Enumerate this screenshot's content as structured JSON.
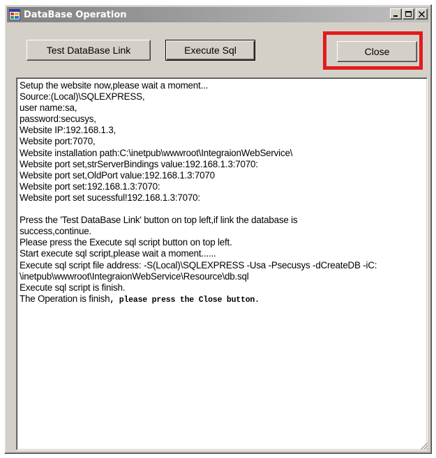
{
  "window": {
    "title": "DataBase Operation",
    "icon": "app-window-icon",
    "controls": {
      "minimize_icon": "minimize-icon",
      "maximize_icon": "maximize-icon",
      "close_icon": "close-icon"
    }
  },
  "toolbar": {
    "test_label": "Test DataBase Link",
    "execute_label": "Execute Sql",
    "close_label": "Close"
  },
  "annotation": {
    "highlight_color": "#e31b1b"
  },
  "log": {
    "lines": [
      "Setup the website now,please wait a moment...",
      "Source:(Local)\\SQLEXPRESS,",
      "user name:sa,",
      "password:secusys,",
      "Website IP:192.168.1.3,",
      "Website port:7070,",
      "Website installation path:C:\\inetpub\\wwwroot\\IntegraionWebService\\",
      "Website port set,strServerBindings value:192.168.1.3:7070:",
      "Website port set,OldPort value:192.168.1.3:7070",
      "Website port set:192.168.1.3:7070:",
      "Website port set sucessful!192.168.1.3:7070:",
      "",
      "Press the 'Test DataBase Link' button on top left,if link the database is",
      "success,continue.",
      "Please press the Execute sql script button on top left.",
      "Start execute sql script,please wait a moment......",
      "Execute sql script file address: -S(Local)\\SQLEXPRESS -Usa -Psecusys -dCreateDB -iC:",
      "\\inetpub\\wwwroot\\IntegraionWebService\\Resource\\db.sql",
      "Execute sql script is finish.",
      "The Operation is finish, please press the Close button."
    ],
    "last_line_prefix": "The Operation is finish",
    "last_line_suffix": ", please press the Close button."
  }
}
